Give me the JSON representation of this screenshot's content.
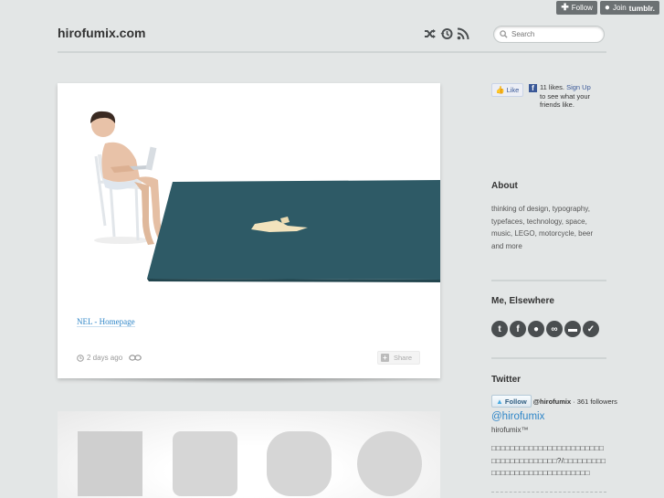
{
  "tumblr_controls": {
    "follow_label": "Follow",
    "join_label": "Join",
    "join_brand": "tumblr."
  },
  "header": {
    "site_title": "hirofumix.com",
    "icons": [
      "shuffle-icon",
      "history-icon",
      "rss-icon"
    ],
    "search_placeholder": "Search"
  },
  "post": {
    "link_text": "NEL - Homepage",
    "time_ago": "2 days ago",
    "share_label": "Share",
    "image_desc_colors": {
      "rug": "#2e5a66",
      "paper": "#f2e3bd"
    }
  },
  "post2": {
    "shapes": [
      "square",
      "rounded-square",
      "squircle",
      "circle"
    ]
  },
  "sidebar": {
    "fb": {
      "like_label": "Like",
      "count_text": "11 likes.",
      "signup_text": "Sign Up",
      "suffix_text": " to see what your friends like."
    },
    "about_heading": "About",
    "about_text": "thinking of design, typography, typefaces, technology, space, music, LEGO, motorcycle, beer and more",
    "elsewhere_heading": "Me, Elsewhere",
    "social_icons": [
      "twitter-icon",
      "facebook-icon",
      "flickr-icon",
      "lastfm-icon",
      "delicious-icon",
      "vimeo-icon"
    ],
    "twitter_heading": "Twitter",
    "twitter": {
      "follow_label": "Follow",
      "handle_small": "@hirofumix",
      "followers": "· 361 followers",
      "handle": "@hirofumix",
      "name": "hirofumix™",
      "tweet": "□□□□□□□□□□□□□□□□□□□□□□□□□□□□□□□□□□□□□□?/□□□□□□□□□□□□□□□□□□□□□□□□□□□□□□"
    }
  },
  "colors": {
    "background": "#e3e6e6",
    "accent": "#2f86c8",
    "icon_dark": "#4a4e50"
  }
}
